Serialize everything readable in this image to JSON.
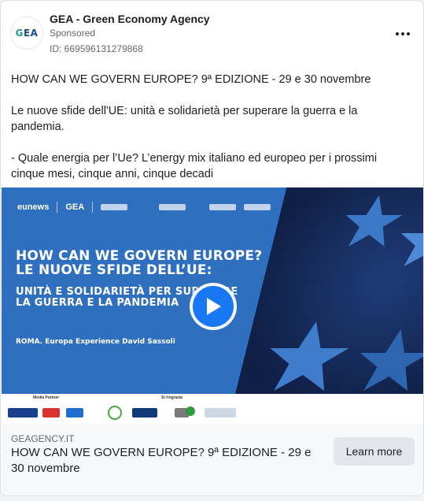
{
  "post": {
    "page_name": "GEA - Green Economy Agency",
    "sponsored_label": "Sponsored",
    "ad_id": "ID: 669596131279868",
    "avatar_logo_g": "G",
    "avatar_logo_ea": "EA",
    "more_icon": "more-horizontal-icon",
    "paragraphs": [
      "HOW CAN WE GOVERN EUROPE? 9ª EDIZIONE - 29 e 30 novembre",
      "Le nuove sfide dell'UE: unità e solidarietà per superare la guerra e la pandemia.",
      "- Quale energia per l’Ue? L’energy mix italiano ed europeo per i prossimi cinque mesi, cinque anni, cinque decadi"
    ],
    "truncation": "..."
  },
  "media": {
    "type": "video",
    "brand_eunews": "eunews",
    "brand_gea": "GEA",
    "headline_lines": [
      "HOW CAN WE GOVERN EUROPE?",
      "LE NUOVE SFIDE DELL’UE:"
    ],
    "sub_lines": [
      "UNITÀ E SOLIDARIETÀ PER SUPERARE",
      "LA GUERRA E LA PANDEMIA"
    ],
    "place": "ROMA. Europa Experience David Sassoli",
    "media_partner_label": "Media Partner",
    "thanks_label": "Si ringrazia",
    "accent_color": "#2f6fc0",
    "play_icon": "play-icon"
  },
  "link": {
    "domain": "GEAGENCY.IT",
    "headline": "HOW CAN WE GOVERN EUROPE? 9ª EDIZIONE - 29 e 30 novembre",
    "cta_label": "Learn more"
  }
}
